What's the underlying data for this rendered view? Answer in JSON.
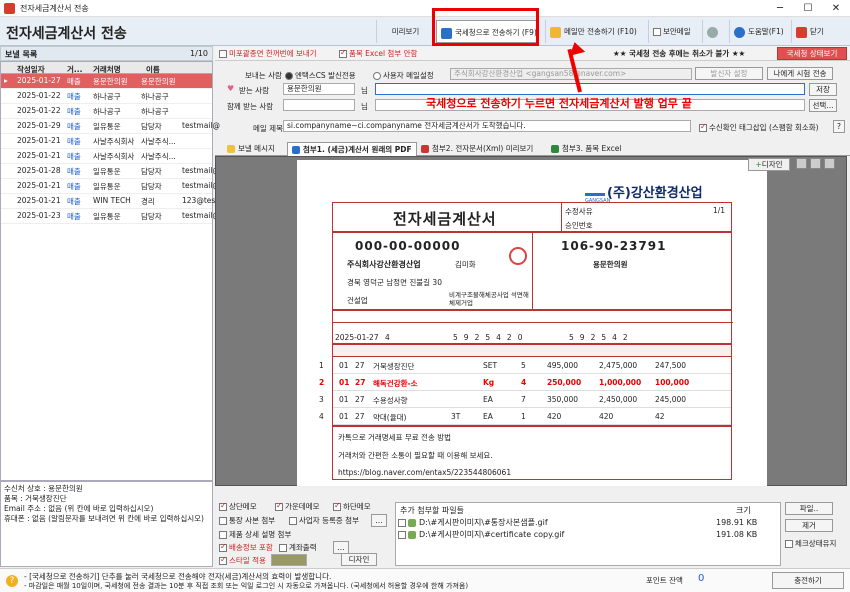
{
  "window": {
    "title": "전자세금계산서 전송",
    "minimize": "─",
    "maximize": "☐",
    "close": "✕"
  },
  "toolbar": {
    "app_title": "전자세금계산서 전송",
    "preview": "미리보기",
    "send_nts": "국세청으로 전송하기 (F9)",
    "send_email_only": "메일만 전송하기 (F10)",
    "secure_mail": "보안메일",
    "help": "도움말(F1)",
    "close": "닫기"
  },
  "left": {
    "header_title": "보낼 목록",
    "count": "1/10",
    "columns": [
      "작성일자",
      "거...",
      "거래처명",
      "이름"
    ],
    "rows": [
      {
        "date": "2025-01-27",
        "type": "매출",
        "client": "용문한의원",
        "name": "용문한의원",
        "email": "",
        "selected": true
      },
      {
        "date": "2025-01-22",
        "type": "매출",
        "client": "하나공구",
        "name": "하나공구",
        "email": ""
      },
      {
        "date": "2025-01-22",
        "type": "매출",
        "client": "하나공구",
        "name": "하나공구",
        "email": ""
      },
      {
        "date": "2025-01-29",
        "type": "매출",
        "client": "일유통운",
        "name": "담당자",
        "email": "testmail@"
      },
      {
        "date": "2025-01-21",
        "type": "매출",
        "client": "사날주식회사",
        "name": "사날주식...",
        "email": ""
      },
      {
        "date": "2025-01-21",
        "type": "매출",
        "client": "사날주식회사",
        "name": "사날주식...",
        "email": ""
      },
      {
        "date": "2025-01-28",
        "type": "매출",
        "client": "일유통운",
        "name": "담당자",
        "email": "testmail@"
      },
      {
        "date": "2025-01-21",
        "type": "매출",
        "client": "일유통운",
        "name": "담당자",
        "email": "testmail@"
      },
      {
        "date": "2025-01-21",
        "type": "매출",
        "client": "WIN TECH",
        "name": "경리",
        "email": "123@test."
      },
      {
        "date": "2025-01-23",
        "type": "매출",
        "client": "일유통운",
        "name": "담당자",
        "email": "testmail@"
      }
    ],
    "info": [
      "수신처 상호 : 용문한의원",
      "품목 : 거북생장진단",
      "Email 주소 : 없음 (위 칸에 바로 입력하십시오)",
      "휴대폰 : 없음 (알림문자를 보내려면 위 칸에 바로 입력하십시오)"
    ]
  },
  "options": {
    "show_old_comp": "미포괄종면 한꺼번에 보내기",
    "attach_excel": "품목 Excel 첨부 안함",
    "notice": "★★ 국세청 전송 후에는 취소가 불가 ★★",
    "status_btn": "국세청 상태보기"
  },
  "form": {
    "sender_label": "보내는 사람",
    "radio_a": "엔택스CS 발신전용",
    "radio_b": "사용자 메일설정",
    "sender_value": "주식회사강산환경산업 <gangsan58@naver.com>",
    "send_setting": "발신자 설정",
    "test_send": "나에게 시험 전송",
    "receiver_label": "받는 사람",
    "receiver_value": "용문한의원",
    "nim": "님",
    "receiver_email": "",
    "save": "저장",
    "cc_label": "함께 받는 사람",
    "cc_value": "",
    "select": "선택...",
    "subject_label": "메일 제목",
    "subject_value": "si.companyname~ci.companyname 전자세금계산서가 도착했습니다.",
    "read_confirm": "수신확인 태그삽입 (스팸함 회소화)",
    "q": "?"
  },
  "tabs": [
    "보낼 메시지",
    "첨부1. (세금)계산서 원래의 PDF",
    "첨부2. 전자문서(Xml) 미리보기",
    "첨부3. 품목 Excel"
  ],
  "callout": "국세청으로 전송하기 누르면 전자세금계산서 발행 업무 끝",
  "preview": {
    "design": "디자인",
    "company_logo": "(주)강산환경산업",
    "logo_sub": "GANGSAN"
  },
  "invoice": {
    "title": "전자세금계산서",
    "approval_label": "승인번호",
    "approval_no": "",
    "mod_label": "수정사유",
    "page": "1/1",
    "sup_brn": "000-00-00000",
    "sup_name": "주식회사강산환경산업",
    "sup_rep": "김미화",
    "sup_addr": "경북 영덕군 남정면 진불길 30",
    "sup_type": "건설업",
    "sup_item": "비계구조물해체공사업 석면해체제거업",
    "cus_brn": "106-90-23791",
    "cus_name": "용문한의원",
    "write_date": "2025-01-27",
    "blank": "4",
    "supply_digits": [
      "5",
      "9",
      "2",
      "5",
      "4",
      "2",
      "0"
    ],
    "tax_digits": [
      "5",
      "9",
      "2",
      "5",
      "4",
      "2"
    ],
    "rows": [
      {
        "m": "01",
        "d": "27",
        "item": "거북생장진단",
        "spec": "",
        "unit": "SET",
        "qty": "5",
        "price": "495,000",
        "supply": "2,475,000",
        "tax": "247,500",
        "note": ""
      },
      {
        "m": "01",
        "d": "27",
        "item": "해독건강환-소",
        "spec": "",
        "unit": "Kg",
        "qty": "4",
        "price": "250,000",
        "supply": "1,000,000",
        "tax": "100,000",
        "note": "",
        "bold": true
      },
      {
        "m": "01",
        "d": "27",
        "item": "수용성사향",
        "spec": "",
        "unit": "EA",
        "qty": "7",
        "price": "350,000",
        "supply": "2,450,000",
        "tax": "245,000",
        "note": ""
      },
      {
        "m": "01",
        "d": "27",
        "item": "약대(율대)",
        "spec": "3T",
        "unit": "EA",
        "qty": "1",
        "price": "420",
        "supply": "420",
        "tax": "42",
        "note": ""
      }
    ],
    "notes": [
      "카톡으로 거래명세표 무료 전송 방법",
      "거래처와 간편한 소통이 필요할 때 이용해 보세요.",
      "https://blog.naver.com/entax5/223544806061"
    ]
  },
  "bottom": {
    "chk_sangdan": "상단메모",
    "chk_center": "가운데메모",
    "chk_hadan": "하단메모",
    "chk_bank": "통장 사본 첨부",
    "chk_bizreg": "사업자 등록증 첨부",
    "chk_product": "제품 상세 설명 첨부",
    "chk_payinfo": "배송정보 포함",
    "chk_account": "계좌출력",
    "chk_style": "스타일 적용",
    "design_btn": "디자인",
    "attach_header": "추가 첨부할 파일들",
    "size_header": "크기",
    "files": [
      {
        "name": "D:\\#게시판이미지\\#통장사본샘플.gif",
        "size": "198.91 KB"
      },
      {
        "name": "D:\\#게시판이미지\\#certificate copy.gif",
        "size": "191.08 KB"
      }
    ],
    "file_btn": "파일..",
    "remove_btn": "제거",
    "check_all": "체크상태유지"
  },
  "status": {
    "line1": "- [국세청으로 전송하기] 단추를 눌러 국세청으로 전송해야 전자(세금)계산서의 효력이 발생합니다.",
    "line2": "- 마감일은 매월 10일이며, 국세청에 전송 결과는 10분 후 직접 조회 또는 익일 로그인 시 자동으로 가져옵니다. (국세청에서 허용할 경우에 한해 가져옴)",
    "point_label": "포인트 잔액",
    "point_value": "0",
    "charge_btn": "충전하기"
  },
  "colors": {
    "accent_red": "#e00000",
    "sel_row": "#e06060",
    "link_blue": "#1a5bd0"
  }
}
